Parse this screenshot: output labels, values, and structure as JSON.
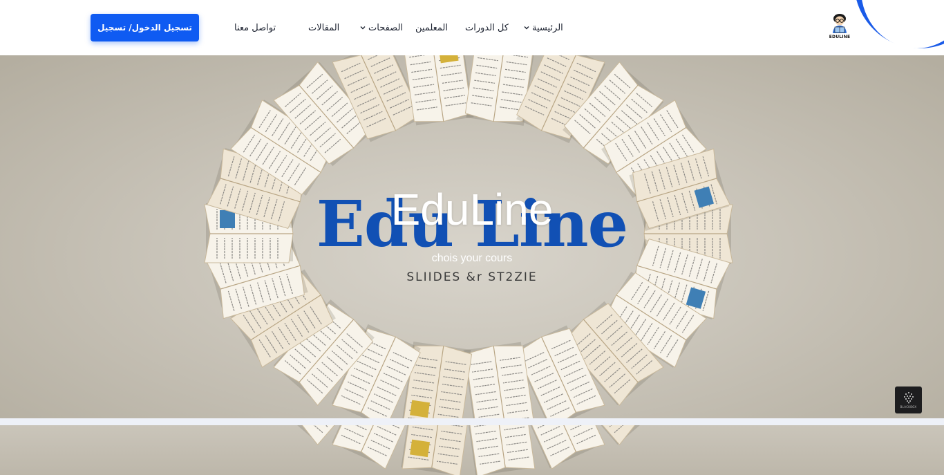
{
  "header": {
    "logo_text": "EDULINE",
    "login_label": "تسجيل الدخول/ تسجيل",
    "nav": [
      {
        "label": "الرئيسية",
        "has_dropdown": true
      },
      {
        "label": "كل الدورات",
        "has_dropdown": false
      },
      {
        "label": "المعلمين",
        "has_dropdown": false
      },
      {
        "label": "الصفحات",
        "has_dropdown": true
      },
      {
        "label": "المقالات",
        "has_dropdown": false
      },
      {
        "label": "تواصل معنا",
        "has_dropdown": false
      }
    ]
  },
  "hero": {
    "title": "EduLine",
    "tagline": "chois your cours",
    "image_word": "Edu Line",
    "image_subtext": "SLIIDES &r ST2ZIE"
  },
  "widget": {
    "label": "BLACKBOX",
    "icon": "blackbox-logo-icon"
  },
  "colors": {
    "primary": "#0f5bf2",
    "accent_blob": "#1a5be8",
    "image_word": "#1150b4"
  }
}
